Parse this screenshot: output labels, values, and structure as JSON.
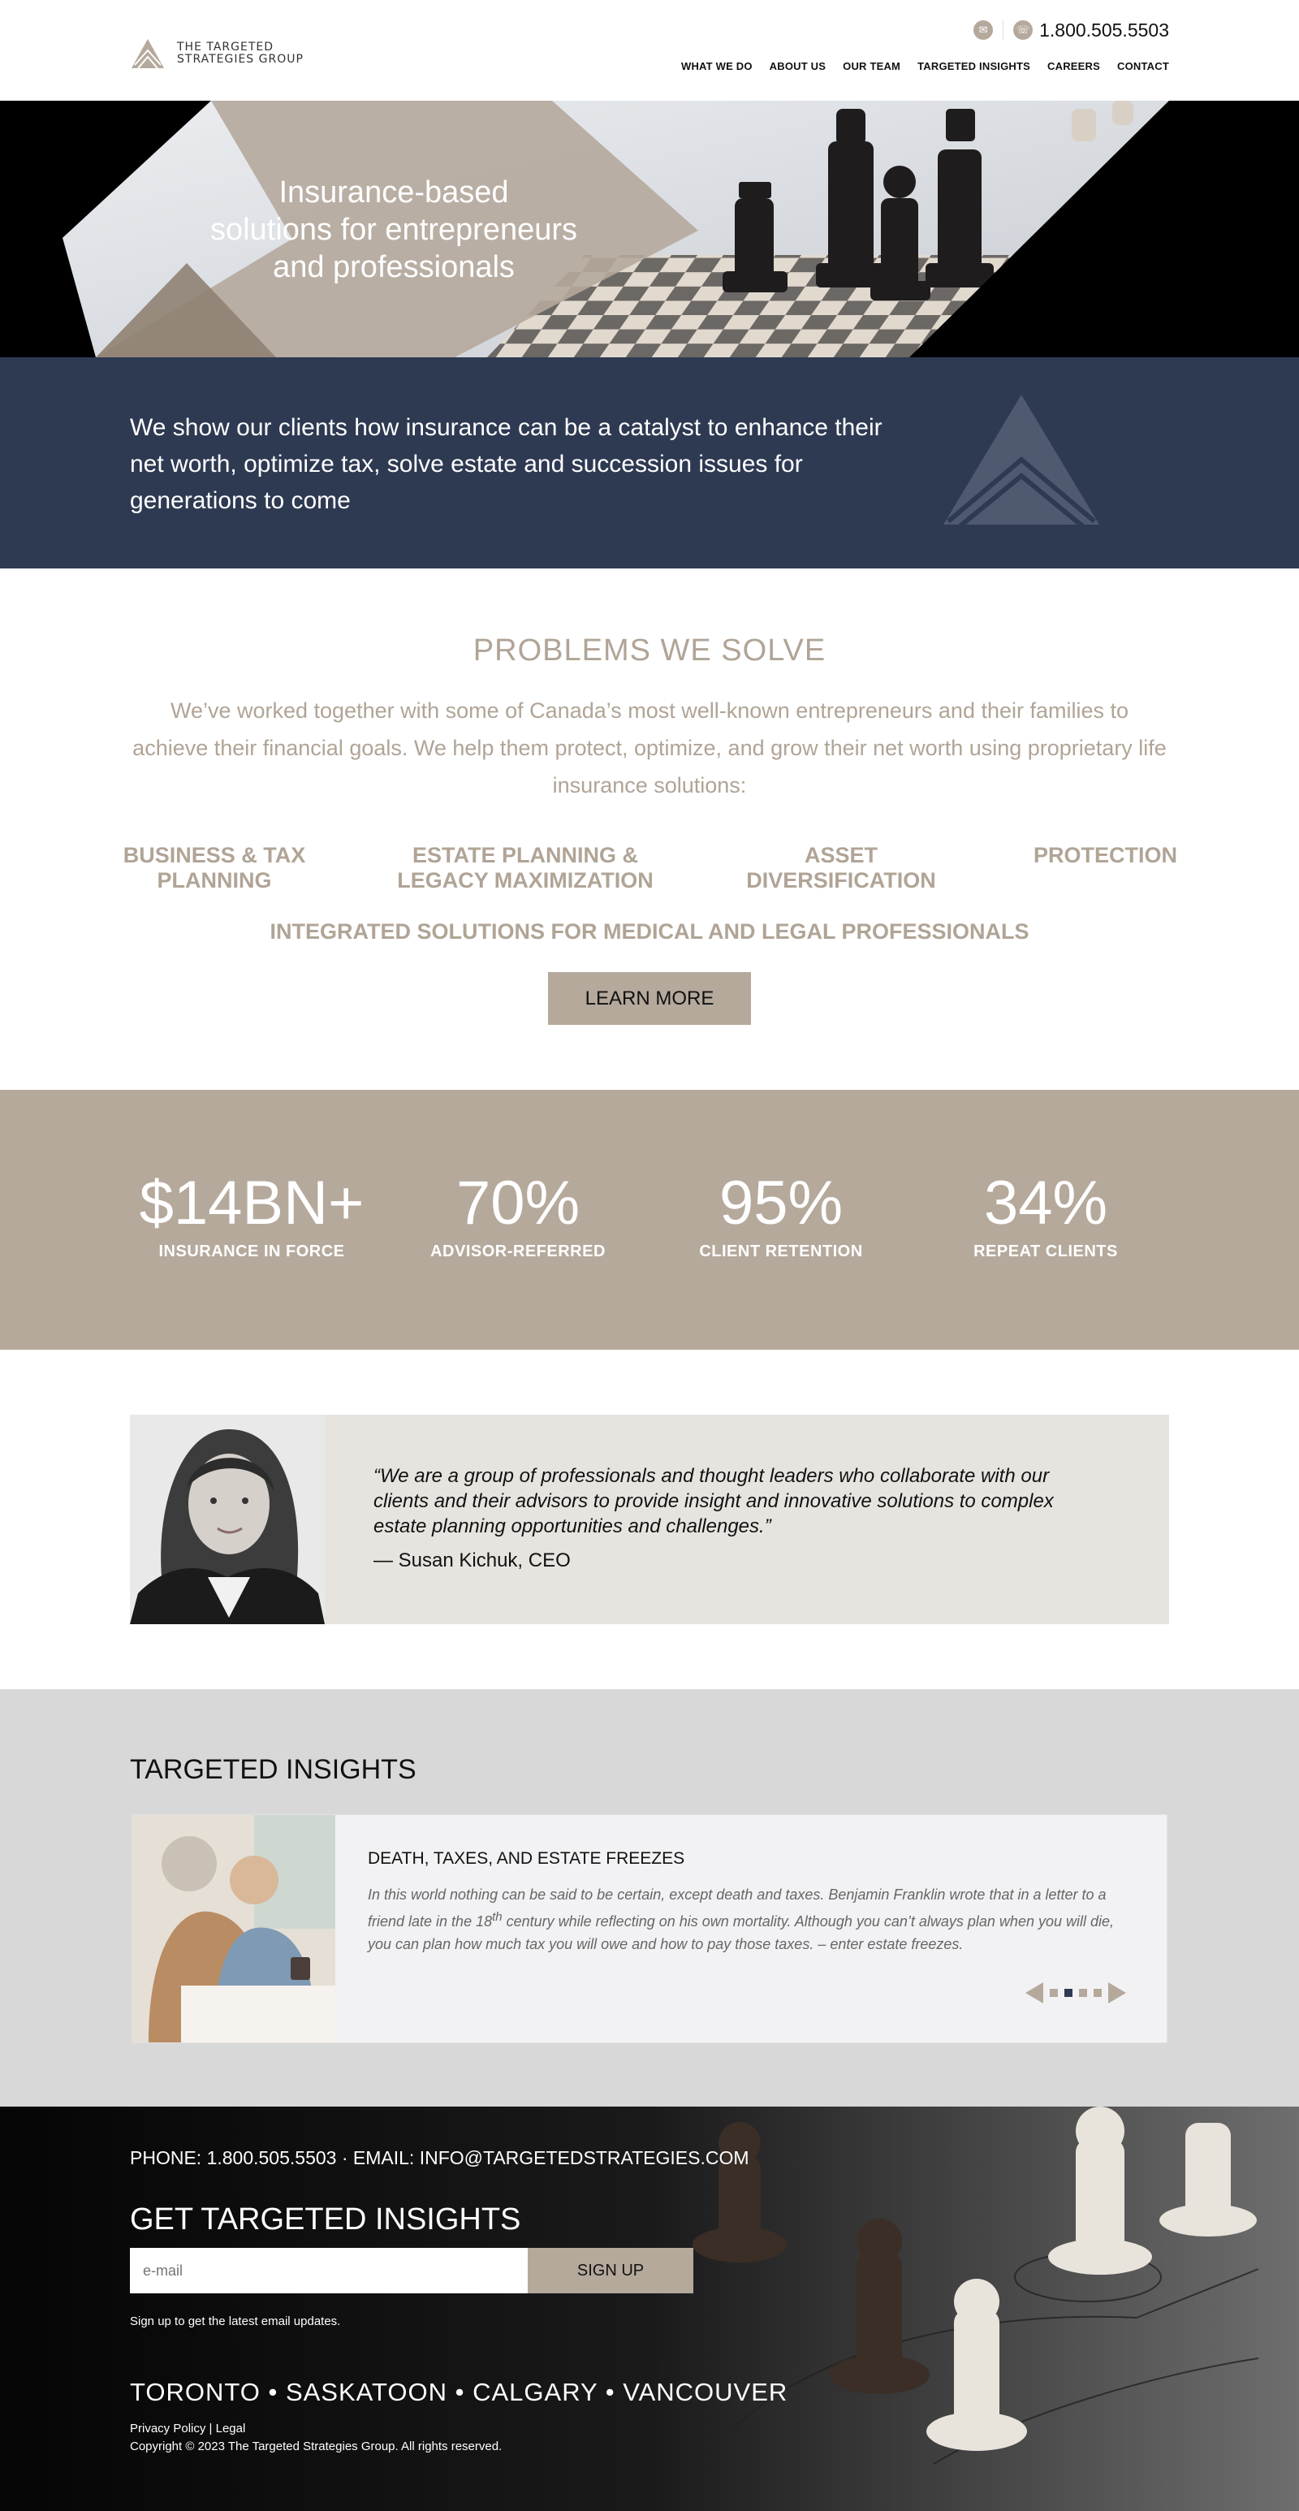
{
  "header": {
    "logo_line1": "THE TARGETED",
    "logo_line2": "STRATEGIES GROUP",
    "phone": "1.800.505.5503",
    "nav": [
      "WHAT WE DO",
      "ABOUT US",
      "OUR TEAM",
      "TARGETED INSIGHTS",
      "CAREERS",
      "CONTACT"
    ]
  },
  "hero": {
    "line1": "Insurance-based",
    "line2": "solutions for entrepreneurs",
    "line3": "and professionals"
  },
  "band": {
    "text": "We show our clients how insurance can be a catalyst to enhance their net worth, optimize tax, solve estate and succession issues for generations to come"
  },
  "problems": {
    "title": "PROBLEMS WE SOLVE",
    "intro": "We’ve worked together with some of Canada’s most well-known entrepreneurs and their families to achieve their financial goals. We help them protect, optimize, and grow their net worth using proprietary life insurance solutions:",
    "services": [
      {
        "line1": "BUSINESS & TAX",
        "line2": "PLANNING"
      },
      {
        "line1": "ESTATE PLANNING &",
        "line2": "LEGACY MAXIMIZATION"
      },
      {
        "line1": "ASSET",
        "line2": "DIVERSIFICATION"
      },
      {
        "line1": "PROTECTION",
        "line2": ""
      }
    ],
    "integrated": "INTEGRATED SOLUTIONS FOR MEDICAL AND LEGAL PROFESSIONALS",
    "learn_more": "LEARN MORE"
  },
  "stats": [
    {
      "value": "$14BN+",
      "label": "INSURANCE IN FORCE"
    },
    {
      "value": "70%",
      "label": "ADVISOR-REFERRED"
    },
    {
      "value": "95%",
      "label": "CLIENT RETENTION"
    },
    {
      "value": "34%",
      "label": "REPEAT CLIENTS"
    }
  ],
  "quote": {
    "text": "“We are a group of professionals and thought leaders who collaborate with our clients and their advisors to provide insight and innovative solutions to complex estate planning opportunities and challenges.”",
    "author": "— Susan Kichuk, CEO"
  },
  "insights": {
    "title": "TARGETED INSIGHTS",
    "article_title": "DEATH, TAXES, AND ESTATE FREEZES",
    "article_excerpt_1": "In this world nothing can be said to be certain, except death and taxes. Benjamin Franklin wrote that in a letter to a friend late in the 18",
    "article_excerpt_sup": "th",
    "article_excerpt_2": " century while reflecting on his own mortality.  Although you can’t always plan when you will die, you can plan how much tax you will owe and how to pay those taxes. – enter estate freezes.",
    "active_slide": 2,
    "slide_count": 4
  },
  "footer": {
    "contact": "PHONE: 1.800.505.5503 · EMAIL: INFO@TARGETEDSTRATEGIES.COM",
    "title": "GET TARGETED INSIGHTS",
    "email_placeholder": "e-mail",
    "signup": "SIGN UP",
    "note": "Sign up to get the latest email updates.",
    "cities": "TORONTO • SASKATOON • CALGARY • VANCOUVER",
    "privacy": "Privacy Policy",
    "separator": "|",
    "legal": "Legal",
    "copyright": "Copyright © 2023 The Targeted Strategies Group. All rights reserved."
  },
  "colors": {
    "accent": "#b5a99c",
    "navy": "#2e3a52",
    "light_gray": "#d8d8d8"
  }
}
